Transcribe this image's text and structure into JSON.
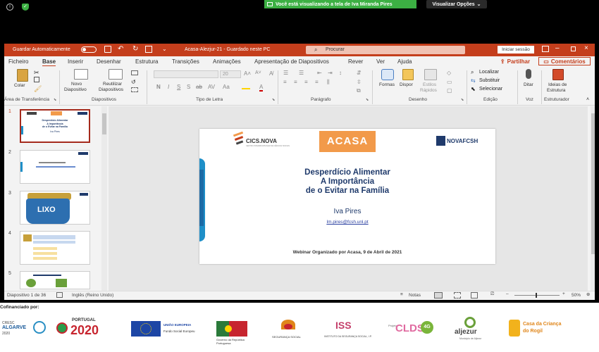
{
  "zoom": {
    "share_banner": "Você está visualizando a tela de Iva Miranda Pires",
    "view_options": "Visualizar Opções"
  },
  "titlebar": {
    "autosave_label": "Guardar Automaticamente",
    "doc_title": "Acasa-Alezjur-21  -  Guardado neste PC",
    "search_placeholder": "Procurar",
    "signin": "Iniciar sessão"
  },
  "menu": {
    "tabs": [
      "Ficheiro",
      "Base",
      "Inserir",
      "Desenhar",
      "Estrutura",
      "Transições",
      "Animações",
      "Apresentação de Diapositivos",
      "Rever",
      "Ver",
      "Ajuda"
    ],
    "share": "Partilhar",
    "comments": "Comentários"
  },
  "ribbon": {
    "paste": "Colar",
    "new_slide_1": "Novo",
    "new_slide_2": "Diapositivo",
    "reuse_1": "Reutilizar",
    "reuse_2": "Diapositivos",
    "font_size": "20",
    "shapes": "Formas",
    "arrange": "Dispor",
    "quick_styles_1": "Estilos",
    "quick_styles_2": "Rápidos",
    "find": "Localizar",
    "replace": "Substituir",
    "select": "Selecionar",
    "dictate": "Ditar",
    "design_ideas_1": "Ideias de",
    "design_ideas_2": "Estrutura",
    "groups": {
      "clipboard": "Área de Transferência",
      "slides": "Diapositivos",
      "font": "Tipo de Letra",
      "paragraph": "Parágrafo",
      "drawing": "Desenho",
      "editing": "Edição",
      "voice": "Voz",
      "designer": "Estruturador"
    }
  },
  "thumbnails": [
    {
      "num": "1",
      "text_1": "Desperdício Alimentar",
      "text_2": "A Importância",
      "text_3": "de o Evitar na Família",
      "text_4": "Iva Pires",
      "selected": true
    },
    {
      "num": "2"
    },
    {
      "num": "3",
      "text_1": "LIXO"
    },
    {
      "num": "4"
    },
    {
      "num": "5"
    }
  ],
  "slide": {
    "logo_cics": "CICS.NOVA",
    "logo_cics_sub": "CENTRO INTERDISCIPLINAR DE CIÊNCIAS SOCIAIS",
    "logo_acasa": "ACASA",
    "logo_nova": "NOVAFCSH",
    "title_1": "Desperdício Alimentar",
    "title_2": "A Importância",
    "title_3": "de o Evitar na Família",
    "author": "Iva Pires",
    "email": "Im.pires@fcsh.unl.pt",
    "footer": "Webinar Organizado por Acasa, 9 de Abril de 2021"
  },
  "status": {
    "slide_count": "Diapositivo 1 de 36",
    "language": "Inglês (Reino Unido)",
    "notes": "Notas",
    "zoom": "50%"
  },
  "cofin": {
    "label": "Cofinanciado por:",
    "logos": {
      "cresc": "CRESC",
      "algarve": "ALGARVE",
      "year2020": "2020",
      "portugal": "PORTUGAL",
      "p2020": "2020",
      "ue": "UNIÃO EUROPEIA",
      "fse": "Fundo Social Europeu",
      "gov": "Governo da República Portuguesa",
      "seg": "SEGURANÇA SOCIAL",
      "iss": "ISS",
      "iss_sub": "INSTITUTO DA SEGURANÇA SOCIAL, I.P.",
      "clds_pre": "Projeto",
      "clds": "CLDS",
      "clds_4g": "4G",
      "aljezur": "aljezur",
      "aljezur_sub": "Município de Aljezur",
      "casa": "Casa da Criança",
      "casa_2": "do Rogil"
    }
  },
  "colors": {
    "ppt_red": "#c43e1c",
    "zoom_green": "#3cb043",
    "acasa_orange": "#f29a4a"
  }
}
